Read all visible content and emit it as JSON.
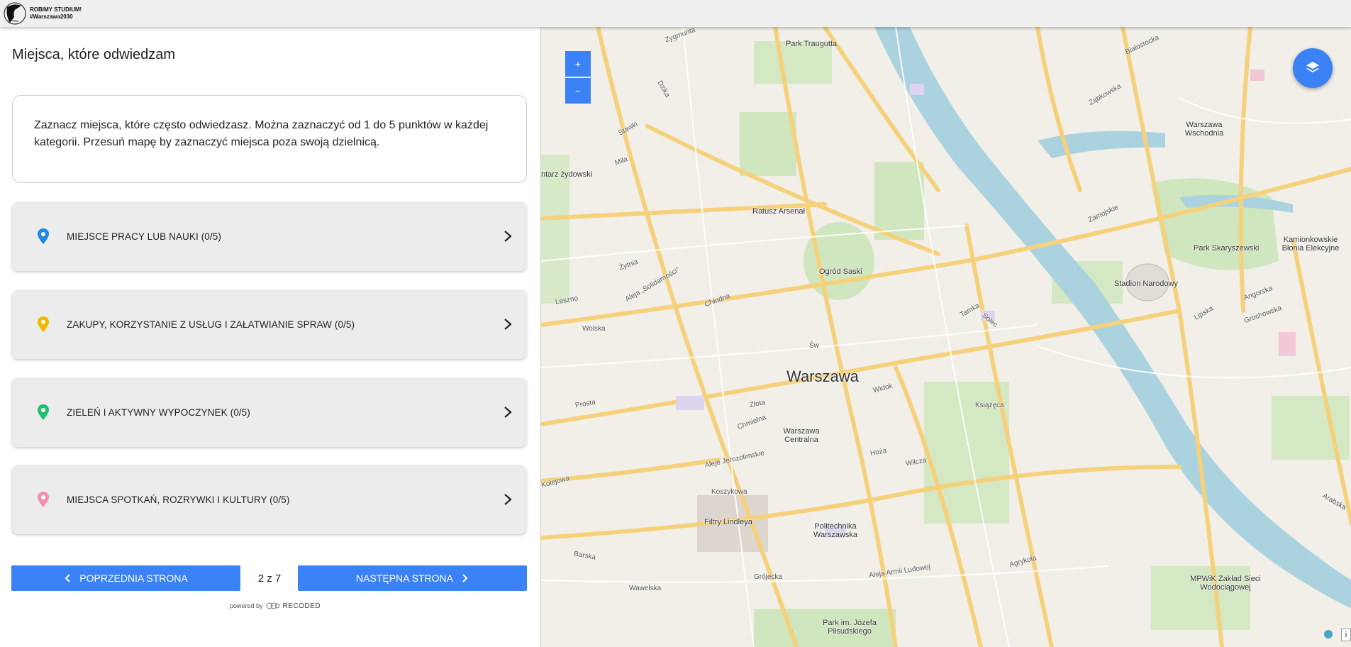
{
  "header": {
    "logo_line1": "ROBIMY STUDIUM!",
    "logo_line2": "#Warszawa2030"
  },
  "page": {
    "title": "Miejsca, które odwiedzam",
    "instructions": "Zaznacz miejsca, które często odwiedzasz. Można zaznaczyć od 1 do 5 punktów w każdej kategorii. Przesuń mapę by zaznaczyć miejsca poza swoją dzielnicą."
  },
  "categories": [
    {
      "label": "MIEJSCE PRACY LUB NAUKI (0/5)",
      "color": "#1e88e5",
      "icon": "map-pin-icon"
    },
    {
      "label": "ZAKUPY, KORZYSTANIE Z USŁUG I ZAŁATWIANIE SPRAW (0/5)",
      "color": "#f5b800",
      "icon": "map-pin-icon"
    },
    {
      "label": "ZIELEŃ I AKTYWNY WYPOCZYNEK (0/5)",
      "color": "#1fbf6f",
      "icon": "map-pin-icon"
    },
    {
      "label": "MIEJSCA SPOTKAŃ, ROZRYWKI I KULTURY (0/5)",
      "color": "#f48fb1",
      "icon": "map-pin-icon"
    }
  ],
  "navigation": {
    "prev_label": "POPRZEDNIA STRONA",
    "next_label": "NASTĘPNA STRONA",
    "pager": "2 z 7"
  },
  "footer": {
    "powered_by": "powered by",
    "brand": "RECODED"
  },
  "map": {
    "zoom_in": "+",
    "zoom_out": "−",
    "info": "i",
    "labels": {
      "city": "Warszawa",
      "park_traugutta": "Park Traugutta",
      "ratusz": "Ratusz Arsenał",
      "ogrod_saski": "Ogród Saski",
      "stadion": "Stadion Narodowy",
      "park_skaryszewski": "Park Skaryszewski",
      "kamionkowskie": "Kamionkowskie Błonia Elekcyjne",
      "warszawa_wschodnia": "Warszawa Wschodnia",
      "warszawa_centralna": "Warszawa Centralna",
      "filtry": "Filtry Lindleya",
      "politechnika": "Politechnika Warszawska",
      "park_pilsudskiego": "Park im. Józefa Piłsudskiego",
      "mpwik": "MPWiK Zakład Sieci Wodociągowej",
      "cmentarz": "ntarz żydowski",
      "aleje_jerozolimskie": "Aleje Jerozolimskie",
      "aleja_solidarnosci": "Aleja „Solidarności”",
      "aleja_armii": "Aleja Armii Ludowej",
      "koszykowa": "Koszykowa",
      "prosta": "Prosta",
      "wolska": "Wolska",
      "leszno": "Leszno",
      "zytnia": "Żytnia",
      "chlodna": "Chłodna",
      "swietokrzyska": "Św",
      "tamka": "Tamka",
      "zamoyskiego": "Zamojskie",
      "wawelska": "Wawelska",
      "grojecka": "Grójecka",
      "agrykola": "Agrykola",
      "dzika": "Dzika",
      "stawki": "Stawki",
      "mila": "Miła",
      "zygmunta": "Zygmunta",
      "bialostocka": "Białostocka",
      "zabkowska": "Ząbkowska",
      "grochowska": "Grochowska",
      "lipska": "Lipska",
      "angorska": "Angorska",
      "arabska": "Arabska",
      "barska": "Barska",
      "ksiazeca": "Książęca",
      "wilcza": "Wilcza",
      "hoza": "Hoża",
      "zlota": "Złota",
      "chmielna": "Chmielna",
      "widok": "Widok",
      "oboźna": "Solec",
      "kolejowa": "Kolejowa"
    }
  }
}
